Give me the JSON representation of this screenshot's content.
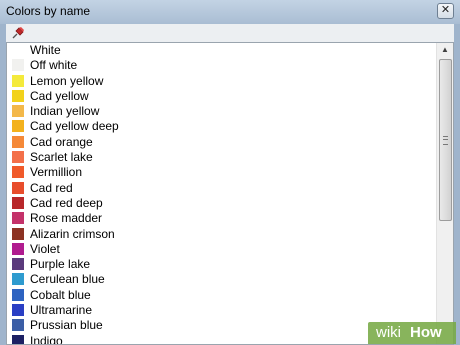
{
  "window": {
    "title": "Colors by name",
    "close_label": "✕"
  },
  "toolbar": {
    "pin_icon": "pushpin-icon"
  },
  "colors": [
    {
      "name": "White",
      "color": "#ffffff"
    },
    {
      "name": "Off white",
      "color": "#f1f1ef"
    },
    {
      "name": "Lemon yellow",
      "color": "#f4ea3c"
    },
    {
      "name": "Cad yellow",
      "color": "#f2d21b"
    },
    {
      "name": "Indian yellow",
      "color": "#f3b84a"
    },
    {
      "name": "Cad yellow deep",
      "color": "#f3b21d"
    },
    {
      "name": "Cad orange",
      "color": "#f58938"
    },
    {
      "name": "Scarlet lake",
      "color": "#f3704a"
    },
    {
      "name": "Vermillion",
      "color": "#f05a2a"
    },
    {
      "name": "Cad red",
      "color": "#e84d2c"
    },
    {
      "name": "Cad red deep",
      "color": "#b8272a"
    },
    {
      "name": "Rose madder",
      "color": "#c4326a"
    },
    {
      "name": "Alizarin crimson",
      "color": "#8c3223"
    },
    {
      "name": "Violet",
      "color": "#b01b8f"
    },
    {
      "name": "Purple lake",
      "color": "#5b3a7c"
    },
    {
      "name": "Cerulean blue",
      "color": "#2e9bcf"
    },
    {
      "name": "Cobalt blue",
      "color": "#2d63c1"
    },
    {
      "name": "Ultramarine",
      "color": "#2a3fc4"
    },
    {
      "name": "Prussian blue",
      "color": "#3b5ea6"
    },
    {
      "name": "Indigo",
      "color": "#1c2063"
    }
  ],
  "watermark": {
    "wiki": "wiki",
    "how": "How"
  }
}
